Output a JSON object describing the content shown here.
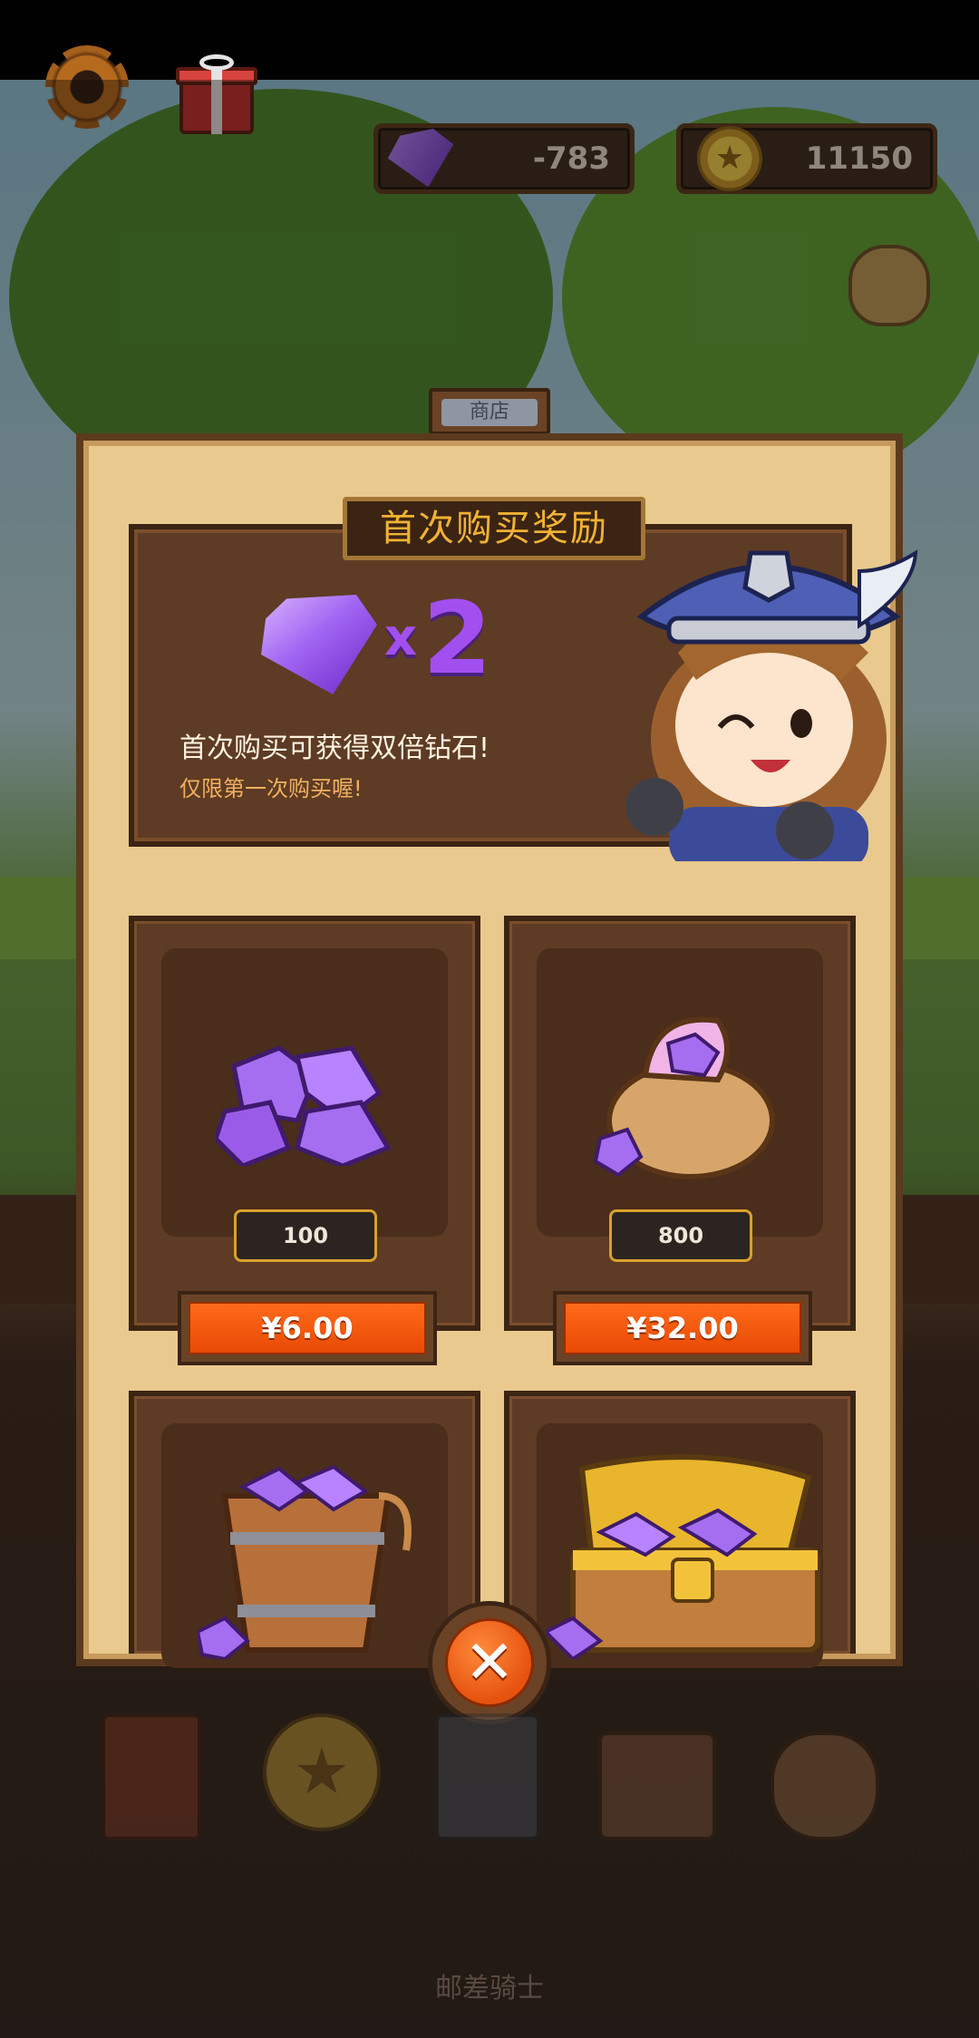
{
  "hud": {
    "settings_icon": "gear-icon",
    "gift_icon": "gift-icon",
    "gems": "-783",
    "coins": "11150"
  },
  "shop": {
    "tab_label": "商店",
    "promo": {
      "title": "首次购买奖励",
      "multiplier": "2",
      "multiplier_prefix": "x",
      "headline": "首次购买可获得双倍钻石!",
      "note": "仅限第一次购买喔!"
    },
    "packs": [
      {
        "quantity": "100",
        "price": "¥6.00",
        "icon": "gem-pile-icon"
      },
      {
        "quantity": "800",
        "price": "¥32.00",
        "icon": "gem-sack-icon"
      },
      {
        "icon": "gem-bucket-icon"
      },
      {
        "icon": "gem-chest-icon"
      }
    ],
    "close_icon": "close-icon"
  },
  "bottom_nav": {
    "icons": [
      "book-icon",
      "star-coin-icon",
      "card-deck-icon",
      "bag-icon",
      "coin-sack-icon"
    ],
    "label": "邮差骑士"
  },
  "colors": {
    "panel": "#e9c98e",
    "card": "#5e3b24",
    "price_button": "#ff6a1a",
    "title_gold": "#f1b234",
    "gem_purple": "#a24ff0"
  }
}
